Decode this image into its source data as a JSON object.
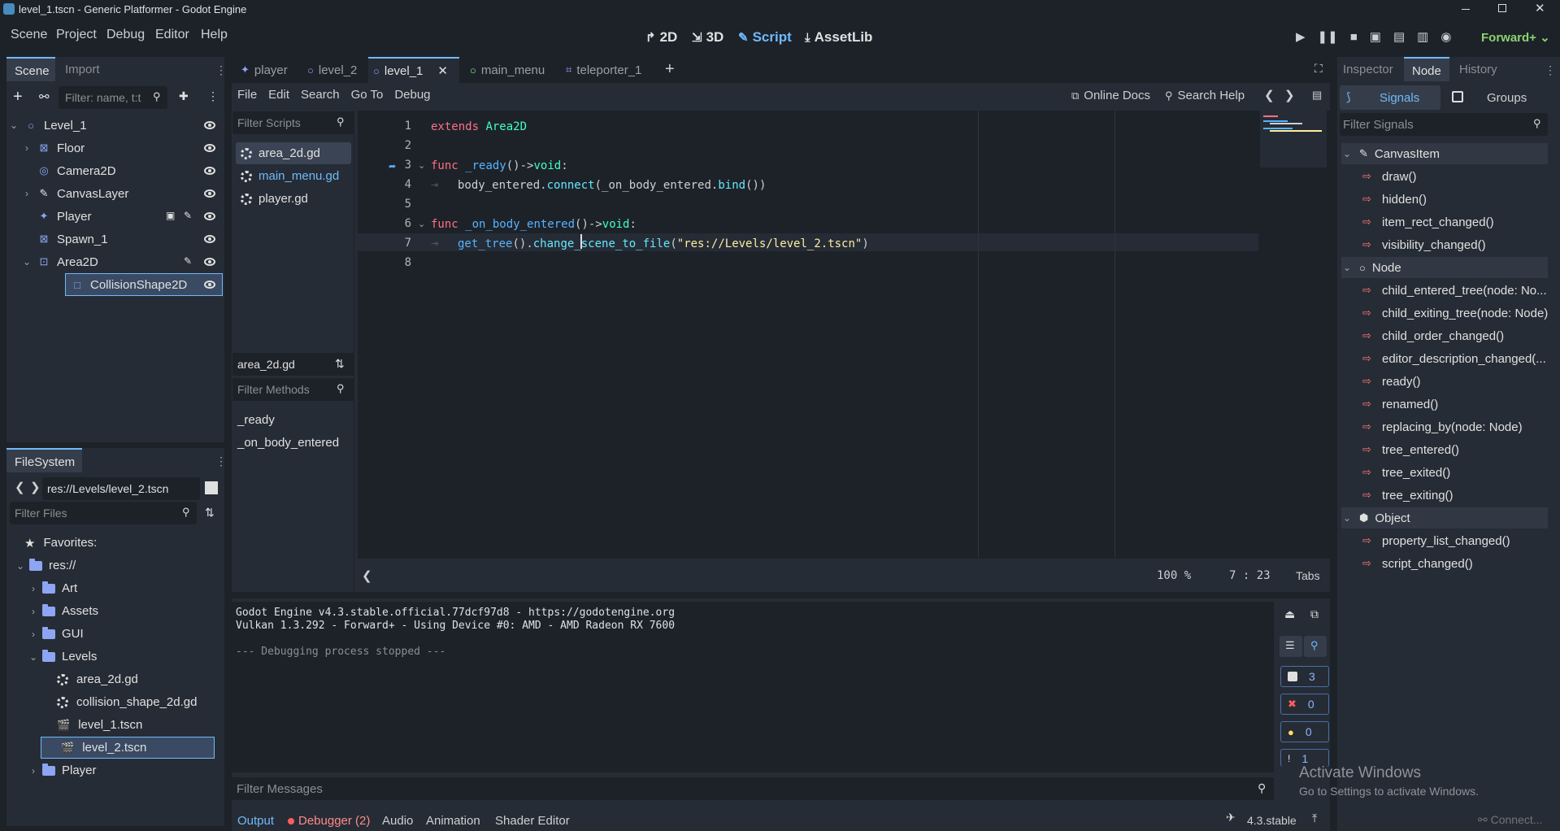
{
  "window": {
    "title": "level_1.tscn - Generic Platformer - Godot Engine"
  },
  "menu": [
    "Scene",
    "Project",
    "Debug",
    "Editor",
    "Help"
  ],
  "workspaces": [
    {
      "label": "2D",
      "icon": "2d-icon",
      "active": false
    },
    {
      "label": "3D",
      "icon": "3d-icon",
      "active": false
    },
    {
      "label": "Script",
      "icon": "script-icon",
      "active": true
    },
    {
      "label": "AssetLib",
      "icon": "assetlib-icon",
      "active": false
    }
  ],
  "renderer": "Forward+",
  "scene_dock": {
    "tabs": [
      "Scene",
      "Import"
    ],
    "filter_placeholder": "Filter: name, t:t",
    "nodes": [
      {
        "name": "Level_1",
        "icon": "node2d-circle-icon",
        "depth": 0,
        "expanded": true
      },
      {
        "name": "Floor",
        "icon": "tilemap-icon",
        "depth": 1,
        "collapsed": true
      },
      {
        "name": "Camera2D",
        "icon": "camera-icon",
        "depth": 1
      },
      {
        "name": "CanvasLayer",
        "icon": "canvaslayer-icon",
        "depth": 1,
        "collapsed": true
      },
      {
        "name": "Player",
        "icon": "player-icon",
        "depth": 1,
        "extra": [
          "scene-instance-icon",
          "script-icon"
        ]
      },
      {
        "name": "Spawn_1",
        "icon": "tilemap-icon",
        "depth": 1
      },
      {
        "name": "Area2D",
        "icon": "area2d-icon",
        "depth": 1,
        "expanded": true,
        "extra": [
          "script-icon"
        ]
      },
      {
        "name": "CollisionShape2D",
        "icon": "collisionshape-icon",
        "depth": 2,
        "selected": true
      }
    ]
  },
  "filesystem": {
    "tab": "FileSystem",
    "path": "res://Levels/level_2.tscn",
    "filter_placeholder": "Filter Files",
    "favorites": "Favorites:",
    "items": [
      {
        "name": "res://",
        "type": "folder",
        "depth": 0,
        "expanded": true
      },
      {
        "name": "Art",
        "type": "folder",
        "depth": 1
      },
      {
        "name": "Assets",
        "type": "folder",
        "depth": 1
      },
      {
        "name": "GUI",
        "type": "folder",
        "depth": 1
      },
      {
        "name": "Levels",
        "type": "folder",
        "depth": 1,
        "expanded": true
      },
      {
        "name": "area_2d.gd",
        "type": "script",
        "depth": 2
      },
      {
        "name": "collision_shape_2d.gd",
        "type": "script",
        "depth": 2
      },
      {
        "name": "level_1.tscn",
        "type": "scene",
        "depth": 2
      },
      {
        "name": "level_2.tscn",
        "type": "scene",
        "depth": 2,
        "selected": true
      },
      {
        "name": "Player",
        "type": "folder",
        "depth": 1
      }
    ]
  },
  "editor_tabs": [
    {
      "label": "player",
      "icon": "player-icon"
    },
    {
      "label": "level_2",
      "icon": "node2d-circle-icon"
    },
    {
      "label": "level_1",
      "icon": "node2d-circle-icon",
      "active": true
    },
    {
      "label": "main_menu",
      "icon": "control-circle-icon"
    },
    {
      "label": "teleporter_1",
      "icon": "scene-icon"
    }
  ],
  "script_menu": [
    "File",
    "Edit",
    "Search",
    "Go To",
    "Debug"
  ],
  "online_docs": "Online Docs",
  "search_help": "Search Help",
  "scripts": {
    "filter_placeholder": "Filter Scripts",
    "list": [
      {
        "name": "area_2d.gd",
        "selected": true
      },
      {
        "name": "main_menu.gd",
        "highlight": true
      },
      {
        "name": "player.gd"
      }
    ],
    "current": "area_2d.gd",
    "methods_placeholder": "Filter Methods",
    "methods": [
      "_ready",
      "_on_body_entered"
    ]
  },
  "code": {
    "lines": [
      {
        "n": "1",
        "text": "extends Area2D"
      },
      {
        "n": "2",
        "text": ""
      },
      {
        "n": "3",
        "text": "func _ready()->void:"
      },
      {
        "n": "4",
        "text": "body_entered.connect(_on_body_entered.bind())"
      },
      {
        "n": "5",
        "text": ""
      },
      {
        "n": "6",
        "text": "func _on_body_entered()->void:"
      },
      {
        "n": "7",
        "text": "get_tree().change_scene_to_file(\"res://Levels/level_2.tscn\")"
      },
      {
        "n": "8",
        "text": ""
      }
    ],
    "zoom": "100 %",
    "line": "7",
    "col": "23",
    "indent": "Tabs"
  },
  "output": {
    "lines": [
      "Godot Engine v4.3.stable.official.77dcf97d8 - https://godotengine.org",
      "Vulkan 1.3.292 - Forward+ - Using Device #0: AMD - AMD Radeon RX 7600",
      "",
      "--- Debugging process stopped ---"
    ],
    "filter_placeholder": "Filter Messages",
    "counts": {
      "messages": "3",
      "errors": "0",
      "warnings": "0",
      "info": "1"
    }
  },
  "bottom_tabs": [
    "Output",
    "Debugger (2)",
    "Audio",
    "Animation",
    "Shader Editor"
  ],
  "version": "4.3.stable",
  "connect_label": "Connect...",
  "watermark": {
    "title": "Activate Windows",
    "sub": "Go to Settings to activate Windows."
  },
  "right_dock": {
    "tabs": [
      "Inspector",
      "Node",
      "History"
    ],
    "subtabs": [
      "Signals",
      "Groups"
    ],
    "filter_placeholder": "Filter Signals",
    "groups": [
      {
        "name": "CanvasItem",
        "signals": [
          "draw()",
          "hidden()",
          "item_rect_changed()",
          "visibility_changed()"
        ]
      },
      {
        "name": "Node",
        "signals": [
          "child_entered_tree(node: No...",
          "child_exiting_tree(node: Node)",
          "child_order_changed()",
          "editor_description_changed(...",
          "ready()",
          "renamed()",
          "replacing_by(node: Node)",
          "tree_entered()",
          "tree_exited()",
          "tree_exiting()"
        ]
      },
      {
        "name": "Object",
        "signals": [
          "property_list_changed()",
          "script_changed()"
        ]
      }
    ]
  },
  "colors": {
    "accent": "#70bafa",
    "renderer": "#8bd36f",
    "error": "#ff5d5d",
    "warning": "#ffdd65"
  }
}
